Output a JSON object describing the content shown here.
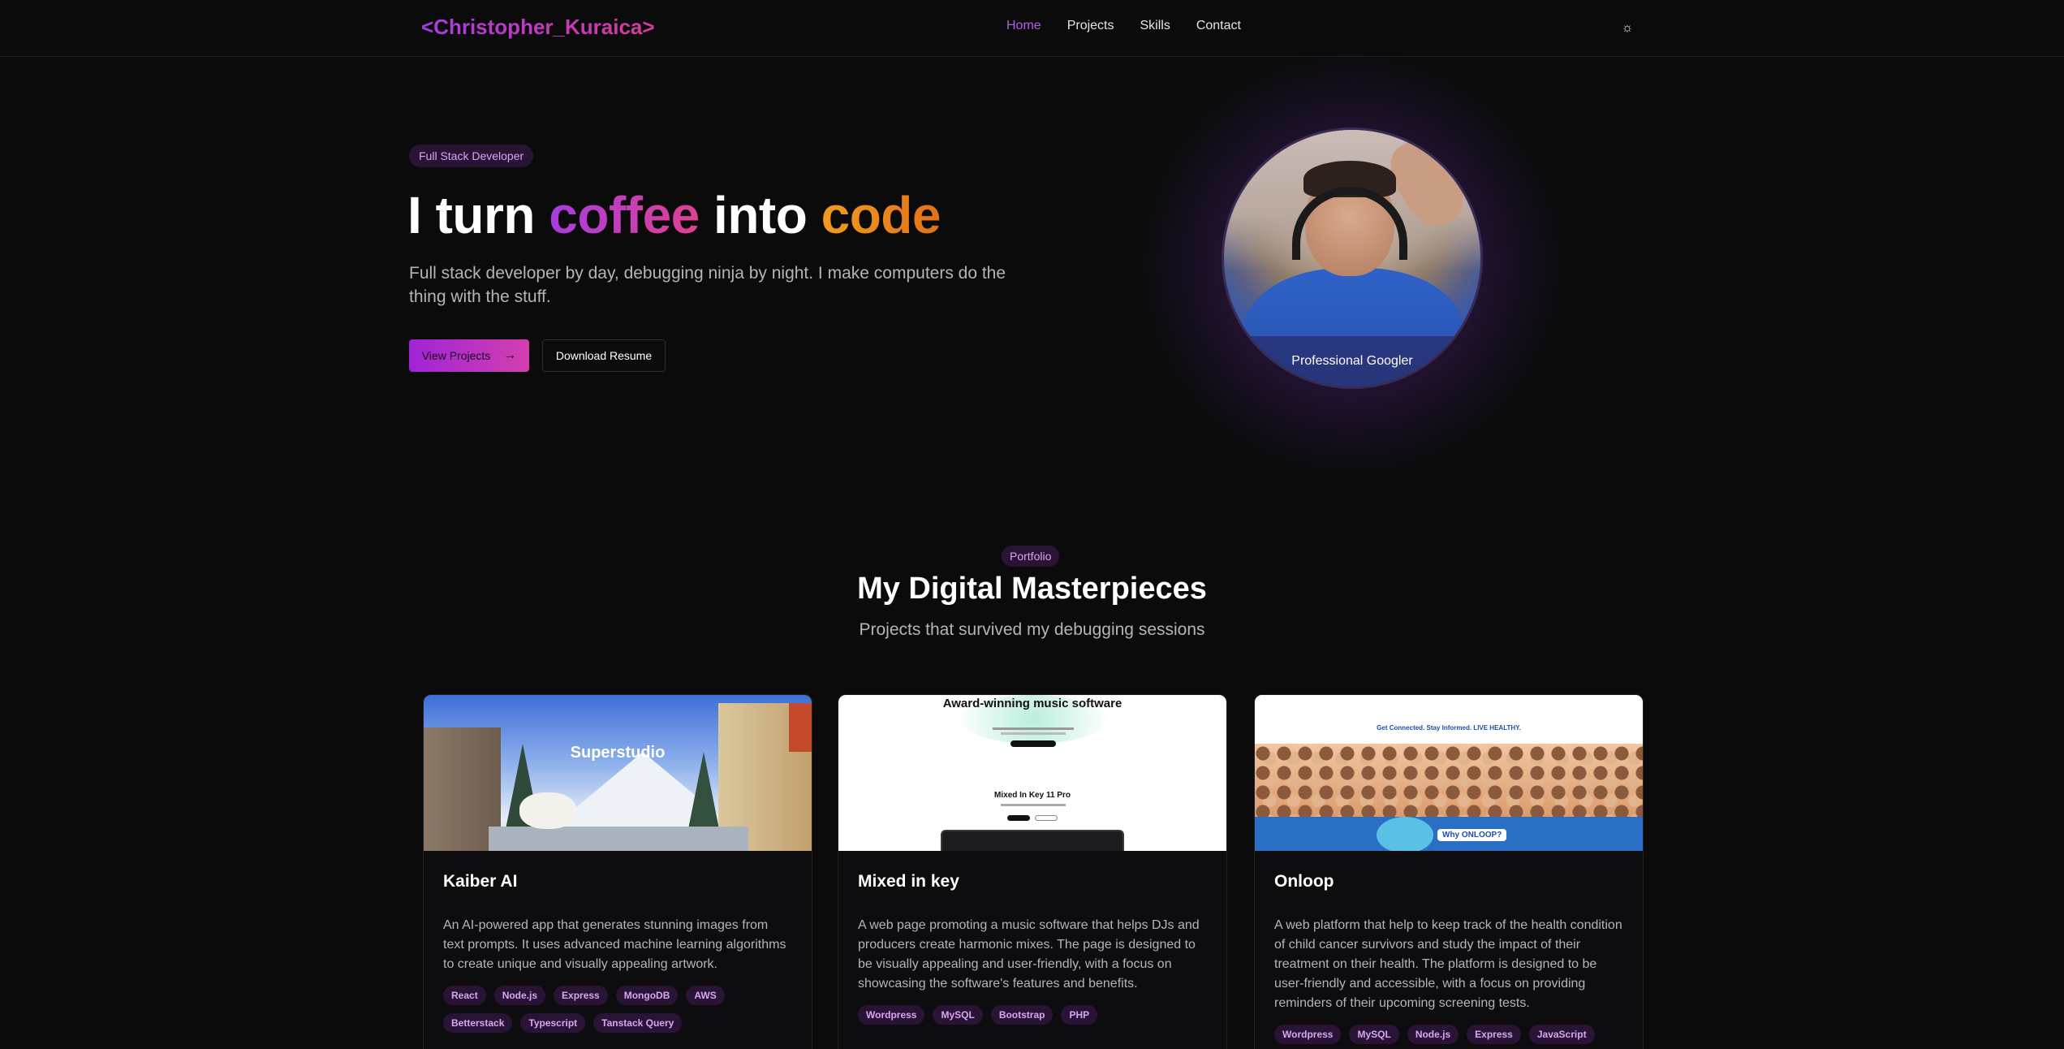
{
  "nav": {
    "logo": "<Christopher_Kuraica>",
    "links": [
      {
        "label": "Home",
        "active": true
      },
      {
        "label": "Projects",
        "active": false
      },
      {
        "label": "Skills",
        "active": false
      },
      {
        "label": "Contact",
        "active": false
      }
    ],
    "theme_icon": "sun-icon",
    "theme_glyph": "☼"
  },
  "hero": {
    "badge": "Full Stack Developer",
    "title_words": [
      "I turn",
      "coffee",
      "into",
      "code"
    ],
    "subtitle": "Full stack developer by day, debugging ninja by night. I make computers do the thing with the stuff.",
    "primary_button": "View Projects",
    "primary_button_icon": "→",
    "secondary_button": "Download Resume",
    "avatar_caption": "Professional Googler"
  },
  "portfolio": {
    "badge": "Portfolio",
    "title": "My Digital Masterpieces",
    "subtitle": "Projects that survived my debugging sessions",
    "projects": [
      {
        "title": "Kaiber AI",
        "description": "An AI-powered app that generates stunning images from text prompts. It uses advanced machine learning algorithms to create unique and visually appealing artwork.",
        "tags": [
          "React",
          "Node.js",
          "Express",
          "MongoDB",
          "AWS",
          "Betterstack",
          "Typescript",
          "Tanstack Query"
        ],
        "image_text": "Superstudio"
      },
      {
        "title": "Mixed in key",
        "description": "A web page promoting a music software that helps DJs and producers create harmonic mixes. The page is designed to be visually appealing and user-friendly, with a focus on showcasing the software's features and benefits.",
        "tags": [
          "Wordpress",
          "MySQL",
          "Bootstrap",
          "PHP"
        ],
        "image_heading": "Award-winning music software",
        "image_subheading": "Mixed In Key 11 Pro"
      },
      {
        "title": "Onloop",
        "description": "A web platform that help to keep track of the health condition of child cancer survivors and study the impact of their treatment on their health. The platform is designed to be user-friendly and accessible, with a focus on providing reminders of their upcoming screening tests.",
        "tags": [
          "Wordpress",
          "MySQL",
          "Node.js",
          "Express",
          "JavaScript"
        ],
        "image_heading": "Get Connected. Stay Informed. LIVE HEALTHY.",
        "image_cta": "Why ONLOOP?"
      }
    ]
  },
  "colors": {
    "accent_purple": "#a63ce0",
    "accent_pink": "#e0418f",
    "accent_orange": "#f29c1f",
    "background": "#0b0b0c"
  }
}
